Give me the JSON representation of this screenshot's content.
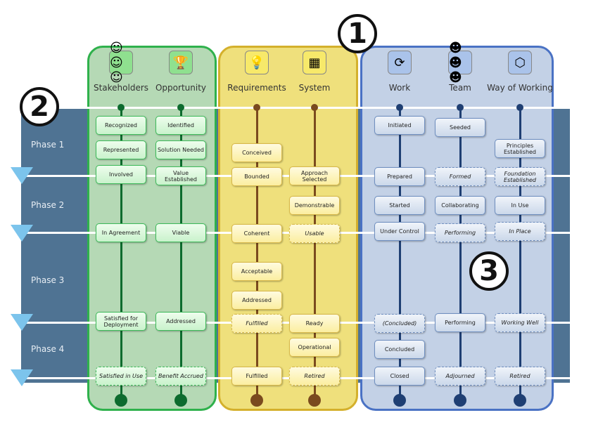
{
  "markers": [
    "1",
    "2",
    "3"
  ],
  "phases": [
    "Phase 1",
    "Phase 2",
    "Phase 3",
    "Phase 4"
  ],
  "colors": {
    "customer": "#2fb14c",
    "solution": "#d4b02c",
    "endeavor": "#4a72c4",
    "band": "#4f7393"
  },
  "alphas": [
    {
      "name": "Stakeholders",
      "icon": "stakeholders-icon",
      "glyph": "☺☺☺",
      "group": "g",
      "states": [
        {
          "label": "Recognized"
        },
        {
          "label": "Represented"
        },
        {
          "label": "Involved"
        },
        {
          "label": "In Agreement"
        },
        {
          "label": "Satisfied for Deployment"
        },
        {
          "label": "Satisfied in Use",
          "dashed": true
        }
      ]
    },
    {
      "name": "Opportunity",
      "icon": "trophy-icon",
      "glyph": "🏆",
      "group": "g",
      "states": [
        {
          "label": "Identified"
        },
        {
          "label": "Solution Needed"
        },
        {
          "label": "Value Established"
        },
        {
          "label": "Viable"
        },
        {
          "label": "Addressed"
        },
        {
          "label": "Benefit Accrued",
          "dashed": true
        }
      ]
    },
    {
      "name": "Requirements",
      "icon": "lightbulb-icon",
      "glyph": "💡",
      "group": "y",
      "states": [
        {
          "label": "Conceived"
        },
        {
          "label": "Bounded"
        },
        {
          "label": "Coherent"
        },
        {
          "label": "Acceptable"
        },
        {
          "label": "Addressed"
        },
        {
          "label": "Fulfilled",
          "dashed": true
        },
        {
          "label": "Fulfilled"
        }
      ]
    },
    {
      "name": "System",
      "icon": "system-diagram-icon",
      "glyph": "▦",
      "group": "y",
      "states": [
        {
          "label": "Approach Selected"
        },
        {
          "label": "Demonstrable"
        },
        {
          "label": "Usable",
          "dashed": true
        },
        {
          "label": "Ready"
        },
        {
          "label": "Operational"
        },
        {
          "label": "Retired",
          "dashed": true
        }
      ]
    },
    {
      "name": "Work",
      "icon": "work-cycle-icon",
      "glyph": "⟳",
      "group": "b",
      "states": [
        {
          "label": "Initiated"
        },
        {
          "label": "Prepared"
        },
        {
          "label": "Started"
        },
        {
          "label": "Under Control"
        },
        {
          "label": "(Concluded)",
          "dashed": true
        },
        {
          "label": "Concluded"
        },
        {
          "label": "Closed"
        }
      ]
    },
    {
      "name": "Team",
      "icon": "team-icon",
      "glyph": "☻☻☻",
      "group": "b",
      "states": [
        {
          "label": "Seeded"
        },
        {
          "label": "Formed",
          "dashed": true
        },
        {
          "label": "Collaborating"
        },
        {
          "label": "Performing",
          "dashed": true
        },
        {
          "label": "Performing"
        },
        {
          "label": "Adjourned",
          "dashed": true
        }
      ]
    },
    {
      "name": "Way of Working",
      "icon": "hexagons-icon",
      "glyph": "⬡",
      "group": "b",
      "states": [
        {
          "label": "Principles Established"
        },
        {
          "label": "Foundation Established",
          "dashed": true
        },
        {
          "label": "In Use"
        },
        {
          "label": "In Place",
          "dashed": true
        },
        {
          "label": "Working Well",
          "dashed": true
        },
        {
          "label": "Retired",
          "dashed": true
        }
      ]
    }
  ]
}
